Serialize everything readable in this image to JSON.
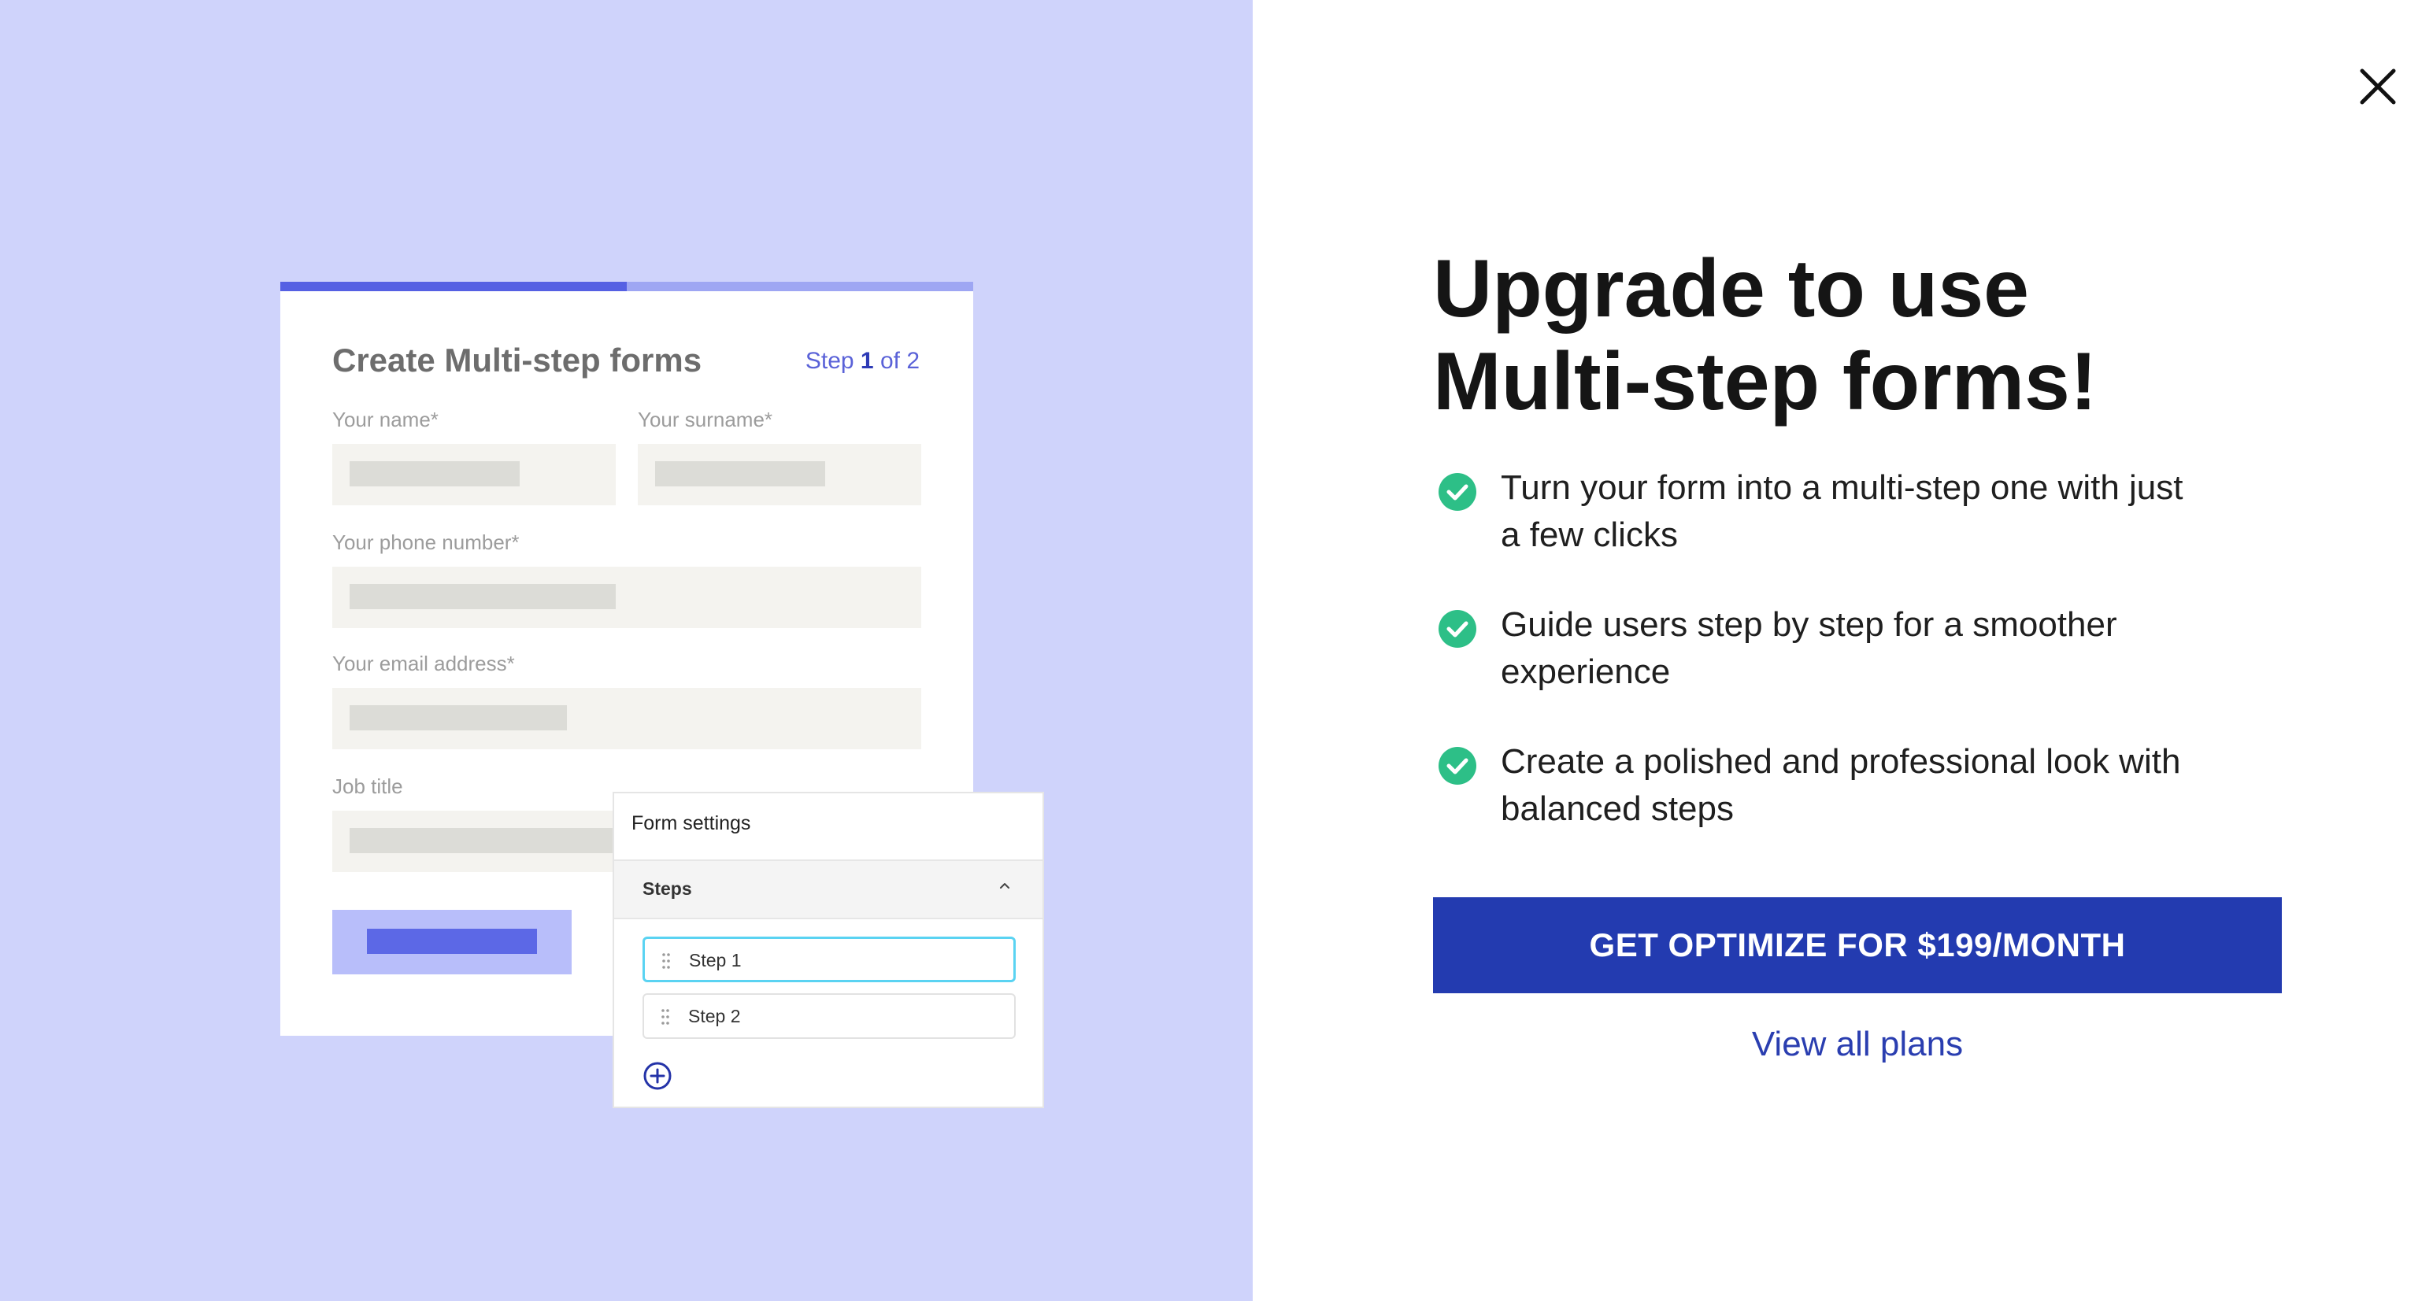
{
  "illustration": {
    "progress_fraction": 0.5,
    "form_title": "Create Multi-step forms",
    "step_indicator": {
      "prefix": "Step ",
      "current": "1",
      "middle": " of ",
      "total": "2"
    },
    "fields": {
      "name_label": "Your name*",
      "surname_label": "Your surname*",
      "phone_label": "Your phone number*",
      "email_label": "Your email address*",
      "job_label": "Job title"
    },
    "settings_panel": {
      "title": "Form settings",
      "section_label": "Steps",
      "steps": [
        "Step 1",
        "Step 2"
      ]
    }
  },
  "modal": {
    "headline_line1": "Upgrade to use",
    "headline_line2": "Multi-step forms!",
    "features": [
      "Turn your form into a multi-step one with just a few clicks",
      "Guide users step by step for a smoother experience",
      "Create a polished and professional look with balanced steps"
    ],
    "cta_label": "GET OPTIMIZE FOR $199/MONTH",
    "view_plans_label": "View all plans"
  },
  "colors": {
    "left_background": "#cfd3fb",
    "progress_fill": "#5560e3",
    "check_green": "#2dbf87",
    "cta_blue": "#233bb0",
    "link_blue": "#2a3eb0"
  }
}
